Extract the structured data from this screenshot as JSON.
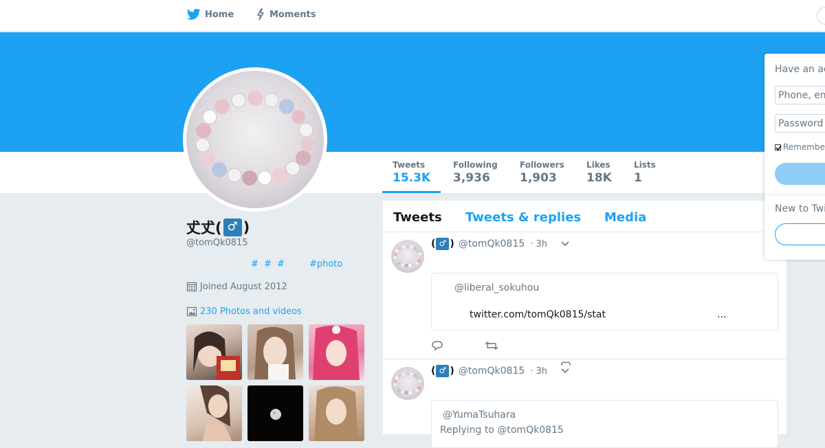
{
  "nav": {
    "home_label": "Home",
    "moments_label": "Moments"
  },
  "profile": {
    "name_prefix": "𠀋𠀋(",
    "name_symbol": "♂",
    "name_suffix": ")",
    "handle": "@tomQk0815",
    "bio_tags": "# # #",
    "bio_tag2": "#photo",
    "joined": "Joined August 2012",
    "photos_link": "230 Photos and videos"
  },
  "stats": [
    {
      "label": "Tweets",
      "value": "15.3K"
    },
    {
      "label": "Following",
      "value": "3,936"
    },
    {
      "label": "Followers",
      "value": "1,903"
    },
    {
      "label": "Likes",
      "value": "18K"
    },
    {
      "label": "Lists",
      "value": "1"
    }
  ],
  "tabs": {
    "tweets": "Tweets",
    "replies": "Tweets & replies",
    "media": "Media"
  },
  "tweets": [
    {
      "name_open": "(",
      "name_symbol": "♂",
      "name_close": ")",
      "handle": "@tomQk0815",
      "time": "· 3h",
      "quote_user": "@liberal_sokuhou",
      "quote_link": "twitter.com/tomQk0815/stat",
      "quote_ellipsis": "..."
    },
    {
      "name_open": "(",
      "name_symbol": "♂",
      "name_close": ")",
      "handle": "@tomQk0815",
      "time": "· 3h",
      "quote_user": "@YumaTsuhara",
      "quote_reply": "Replying to @tomQk0815"
    }
  ],
  "login": {
    "title": "Have an account?",
    "phone_placeholder": "Phone, email or username",
    "password_placeholder": "Password",
    "remember": "Remember me",
    "new_to": "New to Twitter?"
  },
  "colors": {
    "accent": "#1da1f2",
    "banner": "#1da1f2",
    "page_bg": "#e6ecf0",
    "badge": "#2c7fb8"
  }
}
